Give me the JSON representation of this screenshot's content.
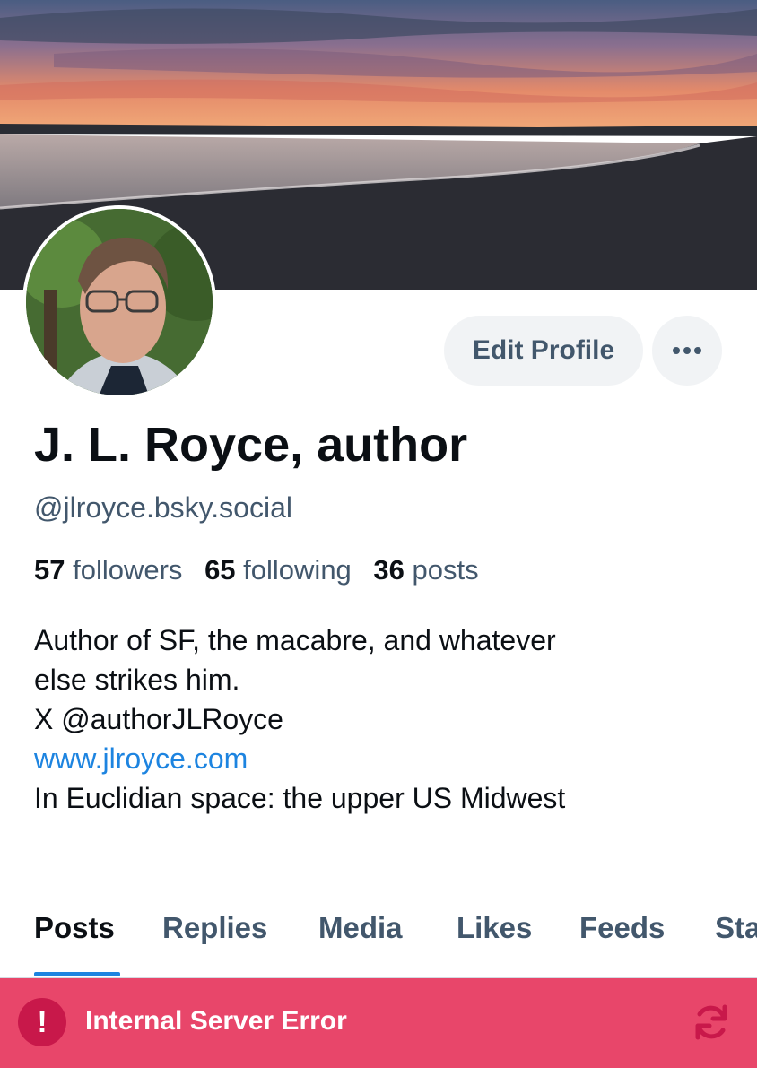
{
  "profile": {
    "display_name": "J. L. Royce, author",
    "handle": "@jlroyce.bsky.social",
    "stats": {
      "followers_count": "57",
      "followers_label": "followers",
      "following_count": "65",
      "following_label": "following",
      "posts_count": "36",
      "posts_label": "posts"
    },
    "bio": {
      "line1": "Author of SF, the macabre, and whatever",
      "line2": "else strikes him.",
      "line3": "X @authorJLRoyce",
      "link": "www.jlroyce.com",
      "line5": "In Euclidian space: the upper US Midwest"
    }
  },
  "actions": {
    "edit_profile_label": "Edit Profile",
    "more_icon": "ellipsis-icon"
  },
  "tabs": [
    {
      "label": "Posts",
      "active": true
    },
    {
      "label": "Replies",
      "active": false
    },
    {
      "label": "Media",
      "active": false
    },
    {
      "label": "Likes",
      "active": false
    },
    {
      "label": "Feeds",
      "active": false
    },
    {
      "label": "Sta",
      "active": false
    }
  ],
  "error": {
    "message": "Internal Server Error",
    "icon": "alert-icon",
    "retry_icon": "refresh-icon"
  },
  "colors": {
    "accent": "#1d84e0",
    "error_bg": "#e8466a",
    "muted_text": "#42576c"
  }
}
